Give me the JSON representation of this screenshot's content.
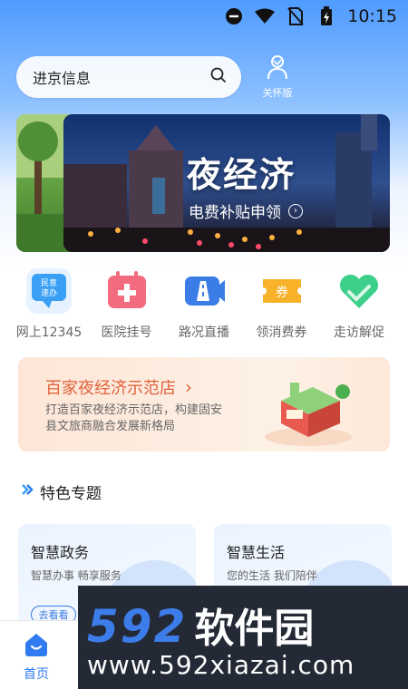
{
  "status_bar": {
    "time": "10:15"
  },
  "search": {
    "text": "进京信息"
  },
  "care_mode": {
    "label": "关怀版"
  },
  "banner": {
    "title": "夜经济",
    "subtitle": "电费补贴申领"
  },
  "services": [
    {
      "label": "网上12345",
      "icon": "message-bubble-icon",
      "icon_text": "民意\n速办",
      "color": "#3aa0f5"
    },
    {
      "label": "医院挂号",
      "icon": "calendar-plus-icon",
      "color": "#f26b7f"
    },
    {
      "label": "路况直播",
      "icon": "road-camera-icon",
      "color": "#3b7de6"
    },
    {
      "label": "领消费券",
      "icon": "coupon-icon",
      "icon_text": "券",
      "color": "#f7b22a"
    },
    {
      "label": "走访解促",
      "icon": "handshake-heart-icon",
      "color": "#3ccf8a"
    }
  ],
  "promo": {
    "title": "百家夜经济示范店",
    "description": "打造百家夜经济示范店，构建固安县文旅商融合发展新格局"
  },
  "section": {
    "title": "特色专题"
  },
  "features": [
    {
      "title": "智慧政务",
      "subtitle": "智慧办事 畅享服务",
      "button": "去看看"
    },
    {
      "title": "智慧生活",
      "subtitle": "您的生活 我们陪伴"
    }
  ],
  "bottom_nav": {
    "home_label": "首页"
  },
  "watermark": {
    "brand_num": "592",
    "brand_cn": "软件园",
    "url": "www.592xiazai.com"
  }
}
